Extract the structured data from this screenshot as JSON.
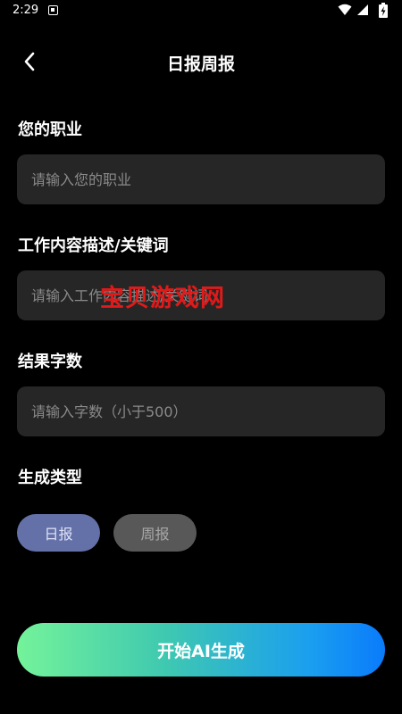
{
  "status_bar": {
    "time": "2:29",
    "icons": [
      "notification-a-icon",
      "wifi-icon",
      "signal-icon",
      "battery-charging-icon"
    ]
  },
  "header": {
    "back_icon": "chevron-left-icon",
    "title": "日报周报"
  },
  "form": {
    "occupation": {
      "label": "您的职业",
      "placeholder": "请输入您的职业",
      "value": ""
    },
    "description": {
      "label": "工作内容描述/关键词",
      "placeholder": "请输入工作内容描述/关键词",
      "value": ""
    },
    "word_count": {
      "label": "结果字数",
      "placeholder": "请输入字数（小于500）",
      "value": ""
    },
    "type": {
      "label": "生成类型",
      "options": [
        "日报",
        "周报"
      ],
      "selected": "日报"
    }
  },
  "watermark": "宝贝游戏网",
  "start_button": {
    "label": "开始AI生成"
  },
  "colors": {
    "background": "#000000",
    "field_bg": "#262626",
    "selected_option": "#6470a8",
    "unselected_option": "#585858",
    "gradient_start": "#74f39a",
    "gradient_end": "#0a7bfb",
    "watermark": "#e01a1a"
  }
}
